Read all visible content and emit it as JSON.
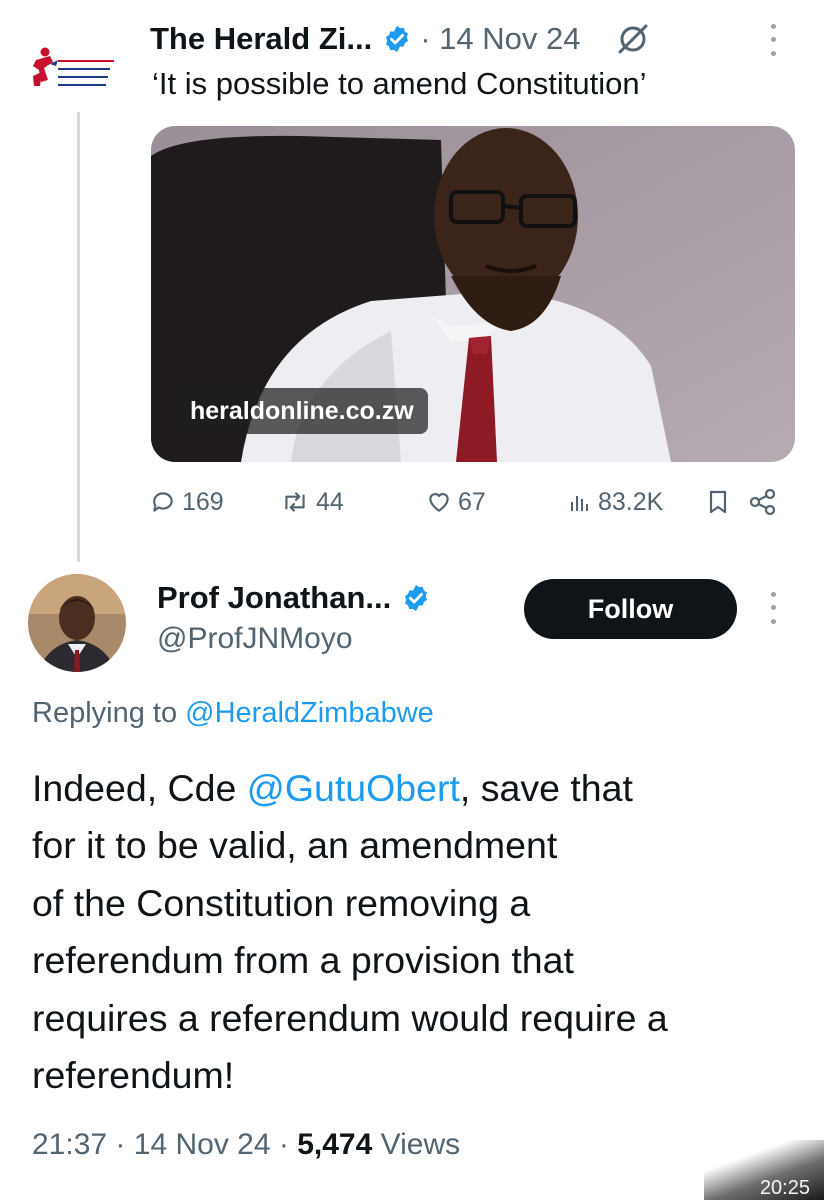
{
  "parent_tweet": {
    "author_name": "The Herald Zi...",
    "date": "· 14 Nov 24",
    "text": "‘It is possible to amend Constitution’",
    "logo_text": "The Herald",
    "link_card_text": "heraldonline.co.zw",
    "metrics": {
      "replies": "169",
      "reposts": "44",
      "likes": "67",
      "views": "83.2K"
    }
  },
  "reply_tweet": {
    "author_name": "Prof Jonathan...",
    "handle": "@ProfJNMoyo",
    "follow_label": "Follow",
    "replying_prefix": "Replying to",
    "replying_to": "@HeraldZimbabwe",
    "body": {
      "l1_a": "Indeed, Cde ",
      "l1_mention": "@GutuObert",
      "l1_b": ", save that",
      "l2": "for it to be valid, an amendment",
      "l3": "of the Constitution removing a",
      "l4": "referendum from a provision that",
      "l5": "requires a referendum would require a",
      "l6": "referendum!"
    },
    "footer": {
      "time": "21:37",
      "sep1": "·",
      "date": "14 Nov 24",
      "sep2": "·",
      "views_count": "5,474",
      "views_label": "Views"
    }
  },
  "status": {
    "clock": "20:25"
  },
  "colors": {
    "link": "#1d9bf0",
    "verified": "#1d9bf0",
    "muted": "#536471",
    "text": "#0f1419",
    "button": "#0f1419"
  }
}
